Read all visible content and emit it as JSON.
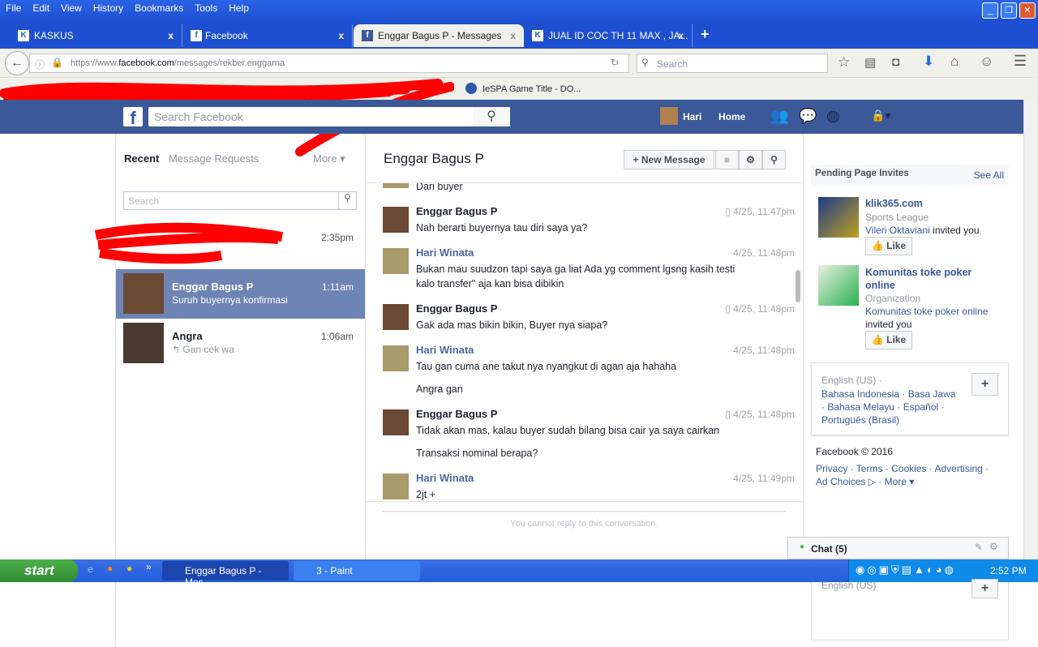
{
  "browser": {
    "menu": [
      "File",
      "Edit",
      "View",
      "History",
      "Bookmarks",
      "Tools",
      "Help"
    ],
    "tabs": [
      {
        "label": "KASKUS",
        "icon": "kaskus-icon"
      },
      {
        "label": "Facebook",
        "icon": "facebook-icon"
      },
      {
        "label": "Enggar Bagus P - Messages",
        "icon": "facebook-icon",
        "active": true
      },
      {
        "label": "JUAL ID COC TH 11 MAX , JA...",
        "icon": "kaskus-icon"
      }
    ],
    "url_prefix": "https://www.",
    "url_domain": "facebook.com",
    "url_path": "/messages/rekber.enggarna",
    "search_placeholder": "Search",
    "bookmark": "IeSPA Game Title - DO..."
  },
  "fb": {
    "search_placeholder": "Search Facebook",
    "user": "Hari",
    "home": "Home"
  },
  "left": {
    "tabs": [
      "Recent",
      "Message Requests"
    ],
    "more": "More",
    "search_placeholder": "Search",
    "threads": [
      {
        "name": "",
        "time": "2:35pm",
        "snippet": ""
      },
      {
        "name": "Enggar Bagus P",
        "time": "1:11am",
        "snippet": "Suruh buyernya konfirmasi",
        "selected": true
      },
      {
        "name": "Angra",
        "time": "1:06am",
        "snippet": "Gan cek wa"
      }
    ]
  },
  "conversation": {
    "title": "Enggar Bagus P",
    "new_message": "New Message",
    "cannot_reply": "You cannot reply to this conversation.",
    "prev_text": "Dari buyer",
    "messages": [
      {
        "sender": "Enggar Bagus P",
        "time": "4/25, 11:47pm",
        "mobile": true,
        "lines": [
          "Nah berarti buyernya tau diri saya ya?"
        ]
      },
      {
        "sender": "Hari Winata",
        "time": "4/25, 11:48pm",
        "lines": [
          "Bukan mau suudzon tapi saya ga liat Ada yg comment lgsng kasih testi kalo transfer\" aja kan bisa dibikin"
        ]
      },
      {
        "sender": "Enggar Bagus P",
        "time": "4/25, 11:48pm",
        "mobile": true,
        "lines": [
          "Gak ada mas bikin bikin, Buyer nya siapa?"
        ]
      },
      {
        "sender": "Hari Winata",
        "time": "4/25, 11:48pm",
        "lines": [
          "Tau gan cuma ane takut nya nyangkut di agan aja hahaha",
          "Angra gan"
        ]
      },
      {
        "sender": "Enggar Bagus P",
        "time": "4/25, 11:48pm",
        "mobile": true,
        "lines": [
          "Tidak akan mas, kalau buyer sudah bilang bisa cair ya saya cairkan",
          "Transaksi nominal berapa?"
        ]
      },
      {
        "sender": "Hari Winata",
        "time": "4/25, 11:49pm",
        "lines": [
          "2jt +"
        ]
      }
    ]
  },
  "right": {
    "invites_title": "Pending Page Invites",
    "see_all": "See All",
    "invites": [
      {
        "page": "klik365.com",
        "category": "Sports League",
        "inviter": "Vileri Oktaviani",
        "invited": " invited you",
        "like": "Like"
      },
      {
        "page": "Komunitas toke poker online",
        "category": "Organization",
        "inviter": "Komunitas toke poker online",
        "invited": "invited you",
        "like": "Like"
      }
    ],
    "languages": {
      "current": "English (US) ·",
      "others": "Bahasa Indonesia · Basa Jawa · Bahasa Melayu · Español · Português (Brasil)"
    },
    "copyright": "Facebook © 2016",
    "footer": "Privacy · Terms · Cookies · Advertising · Ad Choices ▷ · More ▾",
    "chat": "Chat (5)"
  },
  "taskbar": {
    "start": "start",
    "windows": [
      "Enggar Bagus P - Mes...",
      "3 - Paint"
    ],
    "clock": "2:52 PM"
  },
  "residual": {
    "language": "English (US)"
  }
}
